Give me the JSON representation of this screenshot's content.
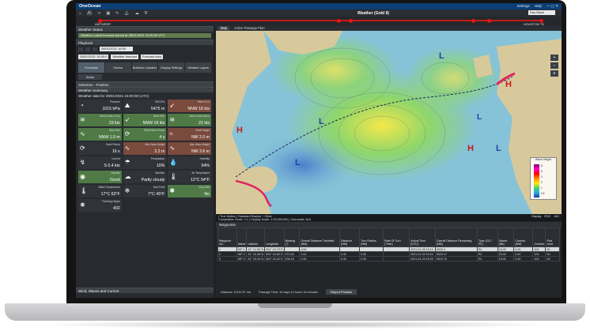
{
  "app": {
    "brand": "OneOcean",
    "title": "Weather (Gold 9)",
    "settings": "Settings",
    "help": "Help",
    "palette": "Day Black"
  },
  "route": {
    "from": "ANTWERP",
    "to": "HOUSTON TX"
  },
  "left": {
    "weather_status_head": "Weather Status",
    "weather_status_text": "Weather Latest forecast issued at 28/01/2021 12:00:00 UTC",
    "playback_head": "Playback",
    "playback_time": "28/01/2021 16:00",
    "playback_date": "28/01/2021 16:00:0",
    "playback_source": "Weather forecast",
    "playback_step": "Forecast step",
    "tabs": [
      {
        "label": "Forecasts"
      },
      {
        "label": "Storms"
      },
      {
        "label": "Bulletins/ Updates"
      },
      {
        "label": "Display Settings"
      },
      {
        "label": "Weather Layers"
      }
    ],
    "areas_tab": "Areas",
    "selection_head": "Selection - Position",
    "summary_head": "Weather Summary",
    "weather_date": "Weather data for 28/01/2021 16:00:00 (UTC)",
    "cells": [
      {
        "title": "Pressure",
        "value": "1015 hPa",
        "icon": "pressure-icon",
        "style": ""
      },
      {
        "title": "500 hPa",
        "value": "5475 m",
        "icon": "altitude-icon",
        "style": ""
      },
      {
        "title": "Wind 10 m",
        "value": "NNW 18 kts",
        "icon": "wind-icon",
        "style": "b"
      },
      {
        "title": "Wind Gusts (10m)",
        "value": "23 kts",
        "icon": "gust-icon",
        "style": "g"
      },
      {
        "title": "Wind 50m",
        "value": "NNW 19 kts",
        "icon": "wind-icon",
        "style": "g"
      },
      {
        "title": "Wind Gusts (50m)",
        "value": "21 kts",
        "icon": "gust-icon",
        "style": "g"
      },
      {
        "title": "Wind Sea",
        "value": "NNW 1.0 m",
        "icon": "wave-icon",
        "style": "g"
      },
      {
        "title": "Wind Wave Period",
        "value": "4 s",
        "icon": "period-icon",
        "style": "g"
      },
      {
        "title": "Swell Height",
        "value": "NW 2.0 m",
        "icon": "swell-icon",
        "style": "b"
      },
      {
        "title": "Swell Period",
        "value": "16 s",
        "icon": "period-icon",
        "style": ""
      },
      {
        "title": "Max Wave Height",
        "value": "2.2 m",
        "icon": "wave-icon",
        "style": "b"
      },
      {
        "title": "Max Wave Height",
        "value": "NW 3.6 m",
        "icon": "wave-icon",
        "style": "b"
      },
      {
        "title": "Current",
        "value": "S 0.4 kts",
        "icon": "current-icon",
        "style": ""
      },
      {
        "title": "Precipitation",
        "value": "10%",
        "icon": "rain-icon",
        "style": ""
      },
      {
        "title": "Humidity",
        "value": "64%",
        "icon": "humidity-icon",
        "style": ""
      },
      {
        "title": "Visibility",
        "value": "Good",
        "icon": "eye-icon",
        "style": "g"
      },
      {
        "title": "Weather",
        "value": "Partly cloudy",
        "icon": "cloud-icon",
        "style": ""
      },
      {
        "title": "Air Temperature",
        "value": "12°C 54°F",
        "icon": "thermometer-icon",
        "style": ""
      },
      {
        "title": "Water Temperature",
        "value": "17°C 63°F",
        "icon": "thermometer-icon",
        "style": ""
      },
      {
        "title": "Dew Point",
        "value": "7°C 45°F",
        "icon": "dew-icon",
        "style": ""
      },
      {
        "title": "Icing Risk",
        "value": "No",
        "icon": "ice-icon",
        "style": "g"
      },
      {
        "title": "Freezing Height",
        "value": "402",
        "icon": "freeze-icon",
        "style": ""
      }
    ],
    "foot_head": "Wind, Waves and Current"
  },
  "map": {
    "tabs": [
      "Map",
      "Active Passage Plan"
    ],
    "status_left": "| True Motion | Standard Display + Other",
    "status_left2": "Compilation Scale: 1:1 | Display Scale: 1:25,000,000 | Overscale: N/A",
    "status_right": [
      "Display",
      "ENC",
      "AIO"
    ],
    "legend_title": "Wave Height",
    "legend_ticks": [
      "8",
      "6",
      "4",
      "2",
      "1",
      "0.5"
    ]
  },
  "waypoints": {
    "head": "Waypoints",
    "general": "GENERAL",
    "columns": [
      "Waypoint No.",
      "Name",
      "Latitude",
      "Longitude",
      "Bearing (°)",
      "Overall Distance Travelled (NM)",
      "Distance (NM)",
      "Turn Radius (NM)",
      "Rate Of Turn (°/min)",
      "Arrival Time (UTC)",
      "Overall Distance Remaining (NM)",
      "Type (GC / RL)",
      "Speed (kts)",
      "Corridor (NM)",
      "Corridor",
      "Port Limit"
    ],
    "rows": [
      [
        "1",
        "WP 1",
        "51° 14.96' N",
        "004° 19.79' E",
        "",
        "0.00",
        "",
        "",
        "",
        "2021-01-28 15:14",
        "5020.4",
        "RL",
        "15.00",
        "0.00",
        "100",
        "50"
      ],
      [
        "2",
        "WP 2",
        "51° 15.38' N",
        "004° 24.83' E",
        "270.42",
        "2.41",
        "2.41",
        "0.00",
        "",
        "2021-01-29 15:24",
        "5020.17",
        "RL",
        "15.00",
        "0.00",
        "100",
        "50"
      ],
      [
        "3",
        "WP 3",
        "51° 15.16' N",
        "004° 24.43' E",
        "235.18",
        "0.33",
        "0.33",
        "0.00",
        "",
        "2021-01-29 15:25",
        "5019.75",
        "RL",
        "15.00",
        "0.00",
        "100",
        "50"
      ]
    ],
    "distance": "Distance: 5,022.57 nm",
    "passage_time": "Passage Time: 15 days 14 hours 16 minutes",
    "report_button": "Report Position"
  },
  "colors": {
    "accent": "#0b3f75",
    "route": "#c71a1a",
    "good": "#4f7a46",
    "warn": "#7a4a3c"
  }
}
